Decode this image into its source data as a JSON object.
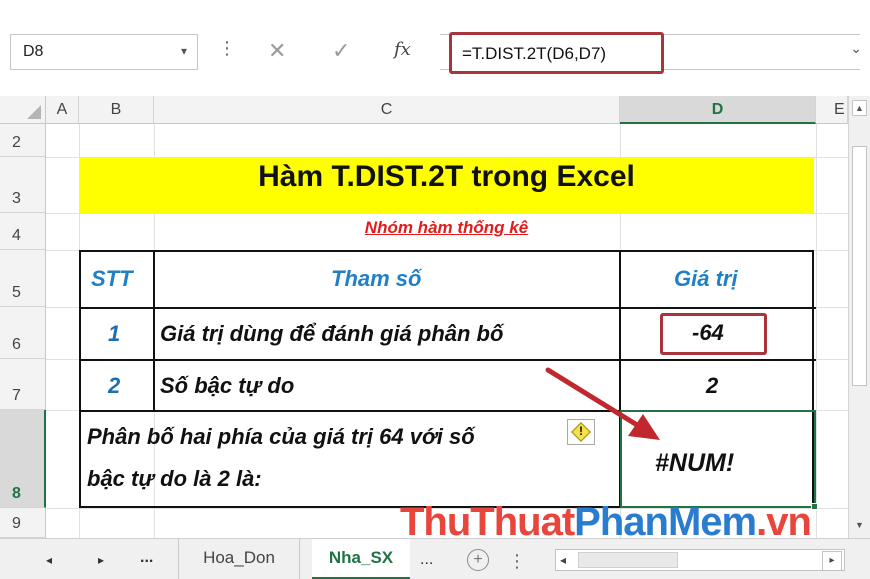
{
  "formula_bar": {
    "name_box": "D8",
    "dropdown_glyph": "▾",
    "dots": "⋮",
    "cancel_glyph": "✕",
    "enter_glyph": "✓",
    "fx": "fx",
    "formula": "=T.DIST.2T(D6,D7)",
    "expand_glyph": "⌄"
  },
  "columns": [
    "A",
    "B",
    "C",
    "D",
    "E"
  ],
  "selected_column": "D",
  "rows": [
    "2",
    "3",
    "4",
    "5",
    "6",
    "7",
    "8",
    "9"
  ],
  "selected_row": "8",
  "sheet": {
    "title": "Hàm T.DIST.2T trong Excel",
    "subtitle": "Nhóm hàm thống kê",
    "table_headers": {
      "stt": "STT",
      "param": "Tham số",
      "value": "Giá trị"
    },
    "rows": [
      {
        "stt": "1",
        "param": "Giá trị dùng để đánh giá phân bố",
        "value": "-64"
      },
      {
        "stt": "2",
        "param": "Số bậc tự do",
        "value": "2"
      }
    ],
    "result_label_line1": "Phân bố hai phía của giá trị 64 với số",
    "result_label_line2": "bậc tự do là 2 là:",
    "result_value": "#NUM!",
    "warning_glyph": "!"
  },
  "watermark": {
    "part1": "ThuThuat",
    "part2": "PhanMem",
    "part3": ".vn"
  },
  "tabs": {
    "nav_prev": "◂",
    "nav_next": "▸",
    "ellipsis_left": "...",
    "sheets": [
      "Hoa_Don",
      "Nha_SX"
    ],
    "active": "Nha_SX",
    "ellipsis_right": "...",
    "add_glyph": "+",
    "separator": "⋮"
  },
  "colors": {
    "accent": "#217346",
    "title_fill": "#ffff00",
    "subtitle": "#e41b1b",
    "header_text": "#1f7fc7",
    "highlight_border": "#a8343c",
    "arrow": "#c0282e"
  },
  "icons": [
    "name-box-dropdown-icon",
    "cancel-icon",
    "enter-icon",
    "function-icon",
    "warning-icon",
    "add-sheet-icon"
  ]
}
